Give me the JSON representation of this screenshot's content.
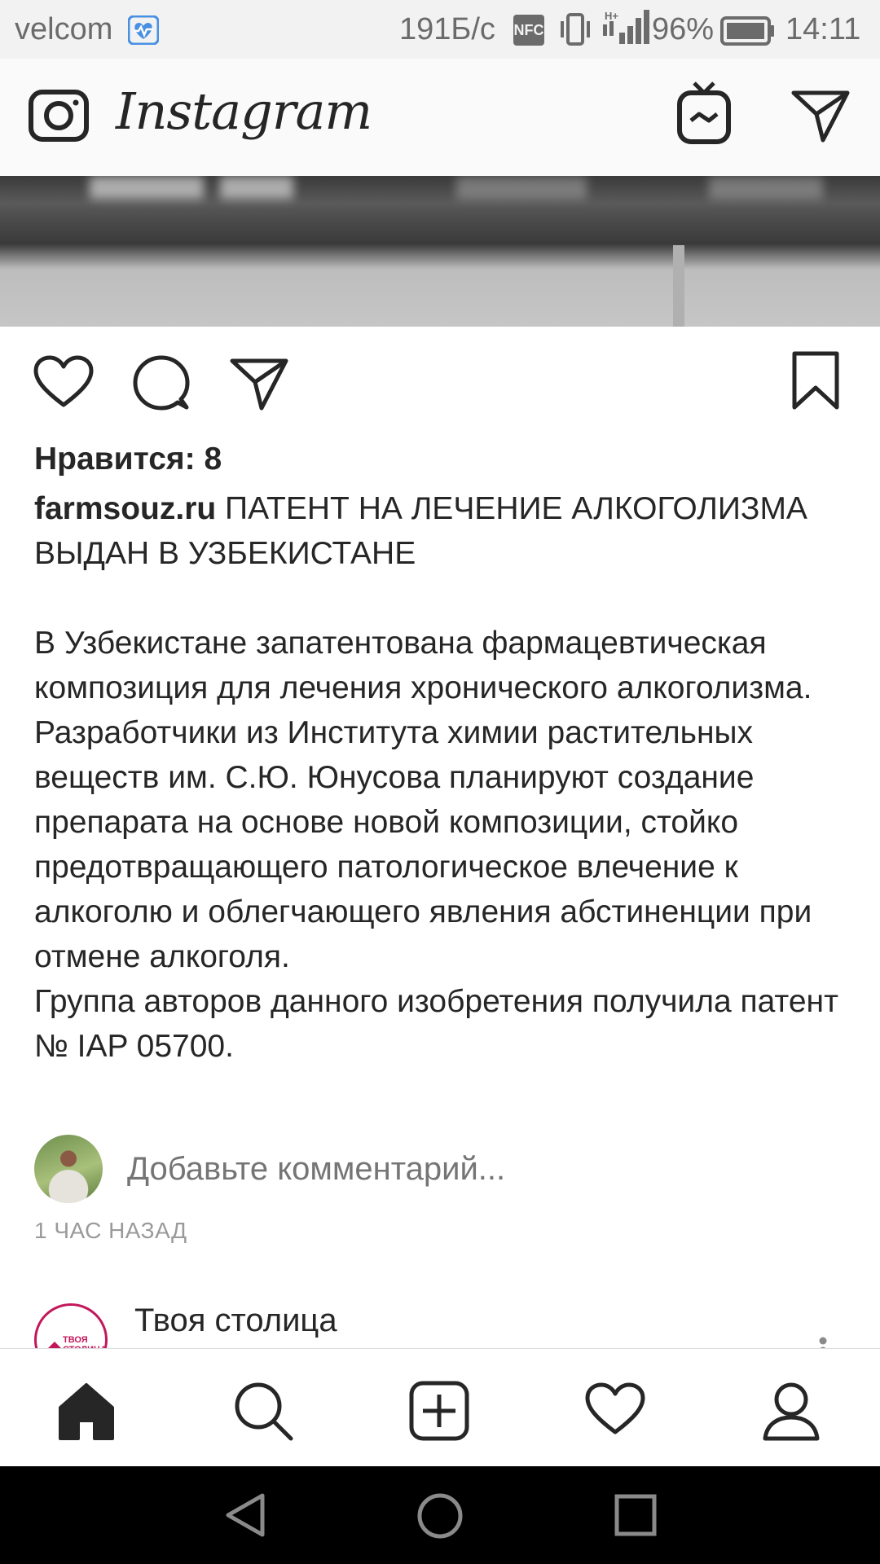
{
  "status_bar": {
    "carrier": "velcom",
    "network_speed": "191Б/с",
    "nfc_label": "NFC",
    "battery_percent": "96%",
    "time": "14:11",
    "health_icon_color": "#4a90e2"
  },
  "header": {
    "app_name": "Instagram",
    "icons": [
      "camera-icon",
      "igtv-icon",
      "direct-message-icon"
    ]
  },
  "post": {
    "actions": [
      "like-icon",
      "comment-icon",
      "share-icon",
      "bookmark-icon"
    ],
    "likes_label": "Нравится: 8",
    "caption_username": "farmsouz.ru",
    "caption_title": " ПАТЕНТ НА ЛЕЧЕНИЕ АЛКОГОЛИЗМА ВЫДАН В УЗБЕКИСТАНЕ",
    "caption_body": "В Узбекистане запатентована фармацевтическая композиция для лечения хронического алкоголизма.\nРазработчики из Института химии растительных веществ им. С.Ю. Юнусова планируют создание препарата на основе новой композиции, стойко предотвращающего патологическое влечение к алкоголю и облегчающего явления абстиненции при отмене алкоголя.\nГруппа авторов данного изобретения получила патент № IAP 05700.",
    "comment_placeholder": "Добавьте комментарий...",
    "time_ago": "1 ЧАС НАЗАД"
  },
  "next_post": {
    "username": "Твоя столица",
    "avatar_text": "ТВОЯ СТОЛИЦА",
    "brand_color": "#c2185b"
  },
  "bottom_nav": {
    "items": [
      "home-icon",
      "search-icon",
      "new-post-icon",
      "activity-icon",
      "profile-icon"
    ],
    "active": "home-icon"
  },
  "system_nav": {
    "items": [
      "back-icon",
      "home-circle-icon",
      "recents-icon"
    ]
  }
}
